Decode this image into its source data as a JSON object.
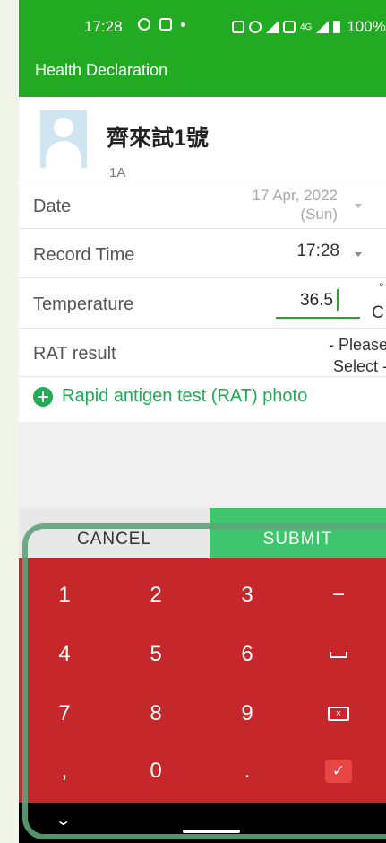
{
  "status_bar": {
    "time": "17:28",
    "network": "4G",
    "battery": "100%"
  },
  "app_bar": {
    "title": "Health Declaration"
  },
  "profile": {
    "name": "齊來試1號",
    "class": "1A"
  },
  "form": {
    "date": {
      "label": "Date",
      "value_line1": "17 Apr, 2022",
      "value_line2": "(Sun)"
    },
    "record_time": {
      "label": "Record Time",
      "value": "17:28"
    },
    "temperature": {
      "label": "Temperature",
      "value": "36.5",
      "unit_symbol": "°",
      "unit_letter": "C"
    },
    "rat_result": {
      "label": "RAT result",
      "value_line1": "- Please",
      "value_line2": "Select -"
    },
    "photo_link": "Rapid antigen test (RAT) photo"
  },
  "buttons": {
    "cancel": "CANCEL",
    "submit": "SUBMIT"
  },
  "keyboard": {
    "rows": [
      [
        "1",
        "2",
        "3",
        "−"
      ],
      [
        "4",
        "5",
        "6",
        "space"
      ],
      [
        "7",
        "8",
        "9",
        "backspace"
      ],
      [
        ",",
        "0",
        ".",
        "done"
      ]
    ],
    "labels": {
      "k1": "1",
      "k2": "2",
      "k3": "3",
      "minus": "−",
      "k4": "4",
      "k5": "5",
      "k6": "6",
      "k7": "7",
      "k8": "8",
      "k9": "9",
      "comma": ",",
      "k0": "0",
      "dot": "."
    }
  },
  "colors": {
    "app_green": "#22aa22",
    "accent_green": "#22aa55",
    "submit_green": "#3ec56e",
    "keyboard_red": "#c5272a"
  }
}
